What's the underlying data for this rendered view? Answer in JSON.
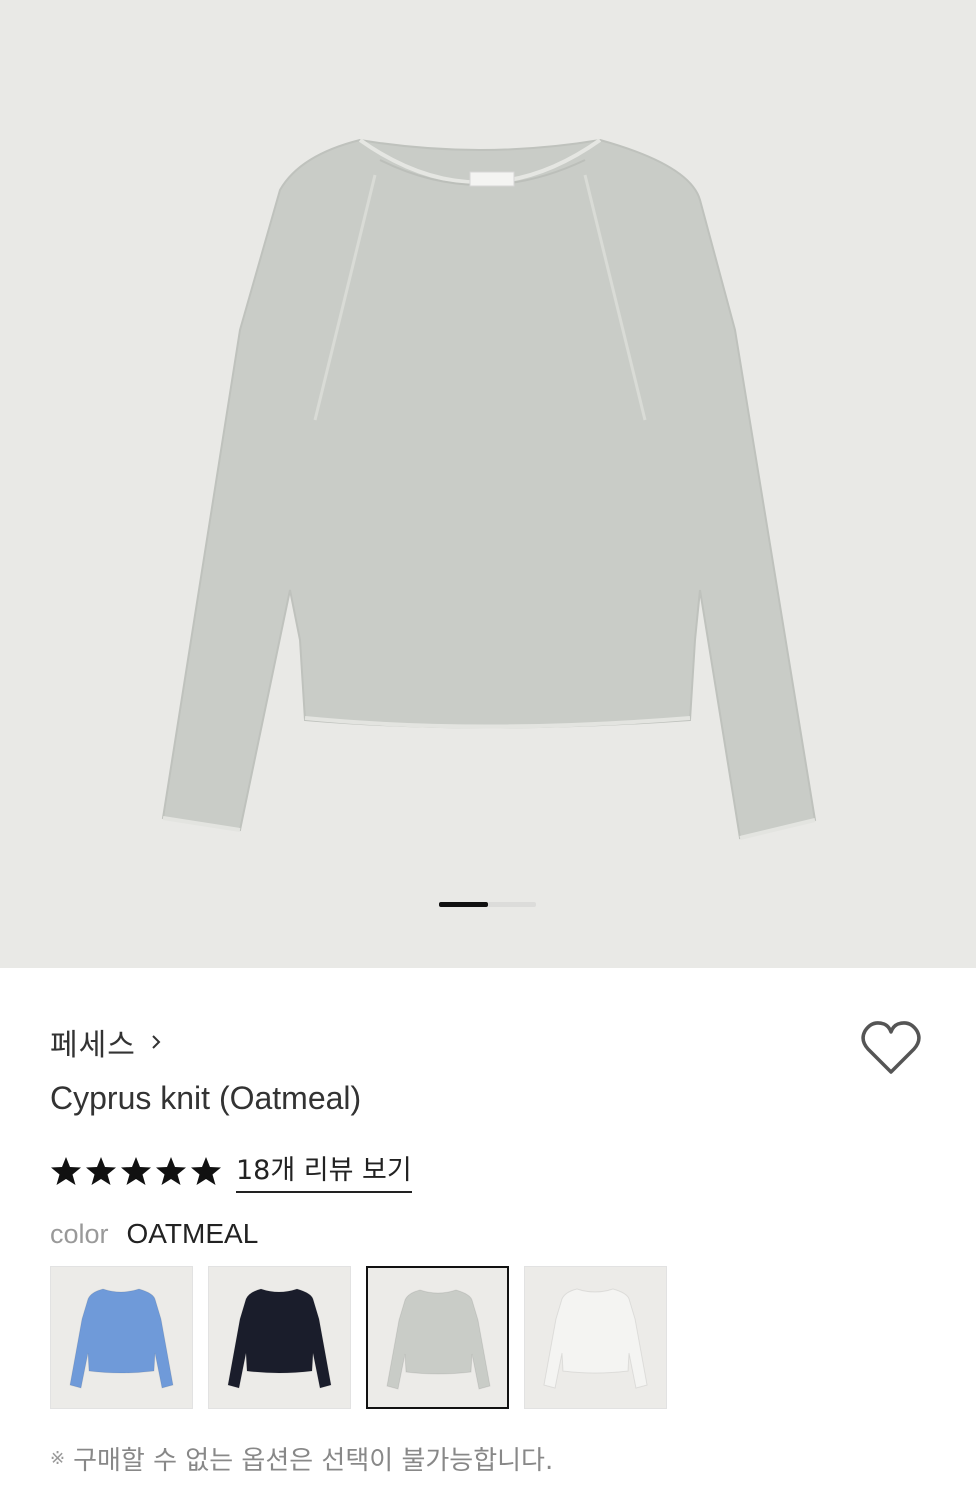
{
  "product": {
    "brand": "페세스",
    "title": "Cyprus knit (Oatmeal)",
    "rating_stars": 5,
    "review_link": "18개 리뷰 보기",
    "color_label": "color",
    "color_value": "OATMEAL",
    "notice_mark": "※",
    "notice": "구매할 수 없는 옵션은 선택이 불가능합니다."
  },
  "gallery": {
    "image_count": 2,
    "current_index": 1,
    "sweater_color": "#c9ccc7",
    "background": "#e9e9e6"
  },
  "swatches": [
    {
      "name": "blue",
      "color": "#6f9ad9",
      "selected": false
    },
    {
      "name": "navy",
      "color": "#1a1d2b",
      "selected": false
    },
    {
      "name": "oatmeal",
      "color": "#c9ccc7",
      "selected": true
    },
    {
      "name": "white",
      "color": "#f4f4f2",
      "selected": false
    }
  ],
  "icons": {
    "brand_chevron": "chevron-right-icon",
    "wishlist": "heart-icon",
    "star": "star-icon"
  }
}
